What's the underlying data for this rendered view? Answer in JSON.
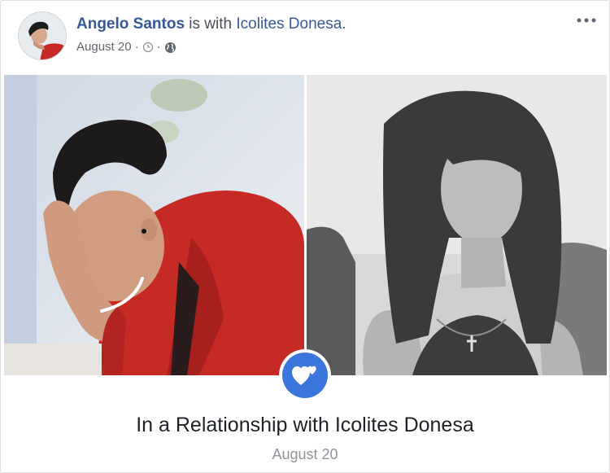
{
  "post": {
    "author": "Angelo Santos",
    "with_text": "is with",
    "tagged": "Icolites Donesa.",
    "date": "August 20",
    "more_icon": "more-options-icon",
    "clock_icon": "clock-icon",
    "privacy_icon": "globe-icon"
  },
  "life_event": {
    "badge_icon": "hearts-icon",
    "badge_color": "#3b76dd",
    "title": "In a Relationship with Icolites Donesa",
    "date": "August 20"
  },
  "colors": {
    "link": "#365899",
    "meta": "#616770",
    "shirt": "#c62a25"
  }
}
